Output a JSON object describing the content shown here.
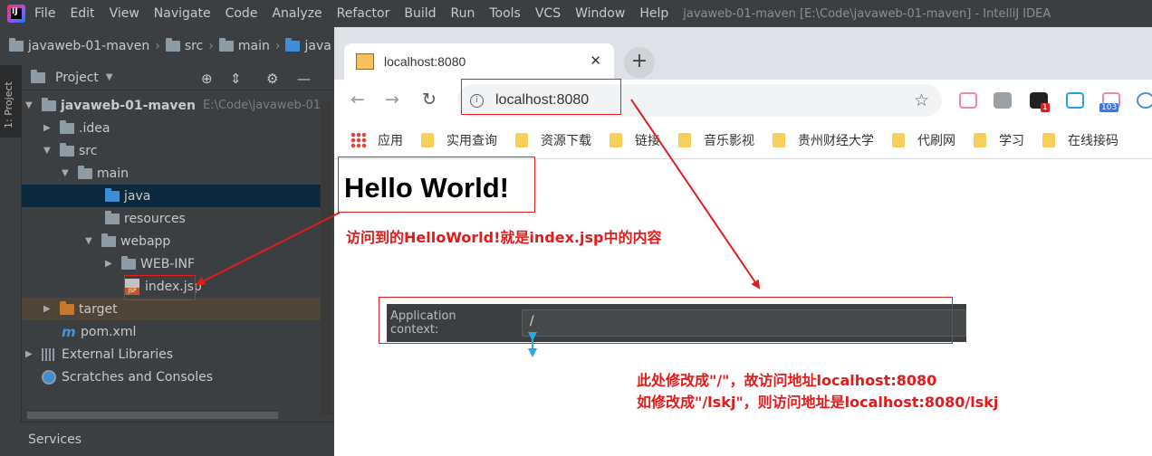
{
  "ide": {
    "menu": [
      "File",
      "Edit",
      "View",
      "Navigate",
      "Code",
      "Analyze",
      "Refactor",
      "Build",
      "Run",
      "Tools",
      "VCS",
      "Window",
      "Help"
    ],
    "window_title": "javaweb-01-maven [E:\\Code\\javaweb-01-maven] - IntelliJ IDEA",
    "breadcrumbs": [
      "javaweb-01-maven",
      "src",
      "main",
      "java"
    ],
    "side_tab": "1: Project",
    "project_panel_title": "Project",
    "tree": [
      {
        "label": "javaweb-01-maven",
        "path": "E:\\Code\\javaweb-01-",
        "icon": "module-folder-icon"
      },
      {
        "label": ".idea",
        "icon": "folder-icon"
      },
      {
        "label": "src",
        "icon": "folder-icon"
      },
      {
        "label": "main",
        "icon": "folder-icon"
      },
      {
        "label": "java",
        "icon": "source-folder-icon"
      },
      {
        "label": "resources",
        "icon": "resources-folder-icon"
      },
      {
        "label": "webapp",
        "icon": "web-folder-icon"
      },
      {
        "label": "WEB-INF",
        "icon": "folder-icon"
      },
      {
        "label": "index.jsp",
        "icon": "jsp-file-icon"
      },
      {
        "label": "target",
        "icon": "excluded-folder-icon"
      },
      {
        "label": "pom.xml",
        "icon": "maven-icon"
      },
      {
        "label": "External Libraries",
        "icon": "library-icon"
      },
      {
        "label": "Scratches and Consoles",
        "icon": "scratches-icon"
      }
    ],
    "services_label": "Services"
  },
  "browser": {
    "tab_title": "localhost:8080",
    "address": "localhost:8080",
    "bookmarks": [
      "应用",
      "实用查询",
      "资源下载",
      "链接",
      "音乐影视",
      "贵州财经大学",
      "代刷网",
      "学习",
      "在线接码"
    ],
    "ext_badges": [
      "1",
      "103"
    ],
    "page_heading": "Hello World!"
  },
  "context_dialog": {
    "label": "Application context:",
    "value": "/"
  },
  "annotations": {
    "note1": "访问到的HelloWorld!就是index.jsp中的内容",
    "note2_line1": "此处修改成\"/\"，故访问地址localhost:8080",
    "note2_line2": "如修改成\"/lskj\"，则访问地址是localhost:8080/lskj"
  },
  "colors": {
    "annotation_red": "#e31b1b",
    "ide_bg": "#3c3f41",
    "selection": "#0d293e"
  }
}
